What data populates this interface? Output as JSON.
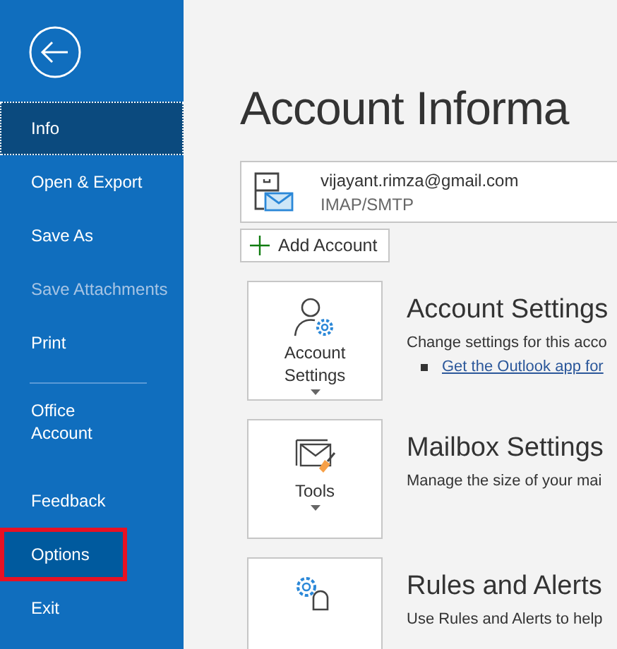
{
  "sidebar": {
    "items": [
      {
        "label": "Info",
        "selected": true,
        "disabled": false,
        "hovered": false,
        "outlined": false,
        "kind": "item"
      },
      {
        "label": "Open & Export",
        "selected": false,
        "disabled": false,
        "hovered": false,
        "outlined": false,
        "kind": "item"
      },
      {
        "label": "Save As",
        "selected": false,
        "disabled": false,
        "hovered": false,
        "outlined": false,
        "kind": "item"
      },
      {
        "label": "Save Attachments",
        "selected": false,
        "disabled": true,
        "hovered": false,
        "outlined": false,
        "kind": "item"
      },
      {
        "label": "Print",
        "selected": false,
        "disabled": false,
        "hovered": false,
        "outlined": false,
        "kind": "item"
      },
      {
        "kind": "divider"
      },
      {
        "label": "Office Account",
        "selected": false,
        "disabled": false,
        "hovered": false,
        "outlined": false,
        "kind": "wrapped-item"
      },
      {
        "label": "Feedback",
        "selected": false,
        "disabled": false,
        "hovered": false,
        "outlined": false,
        "kind": "item"
      },
      {
        "label": "Options",
        "selected": false,
        "disabled": false,
        "hovered": true,
        "outlined": true,
        "kind": "item"
      },
      {
        "label": "Exit",
        "selected": false,
        "disabled": false,
        "hovered": false,
        "outlined": false,
        "kind": "item"
      }
    ]
  },
  "main": {
    "title": "Account Informa",
    "account": {
      "email": "vijayant.rimza@gmail.com",
      "type": "IMAP/SMTP"
    },
    "add_account": "Add Account",
    "sections": [
      {
        "tile_label": "Account Settings",
        "dropdown": true,
        "heading": "Account Settings",
        "description": "Change settings for this acco",
        "link": "Get the Outlook app for"
      },
      {
        "tile_label": "Tools",
        "dropdown": true,
        "heading": "Mailbox Settings",
        "description": "Manage the size of your mai"
      },
      {
        "dropdown": false,
        "heading": "Rules and Alerts",
        "description": "Use Rules and Alerts to help"
      }
    ]
  }
}
